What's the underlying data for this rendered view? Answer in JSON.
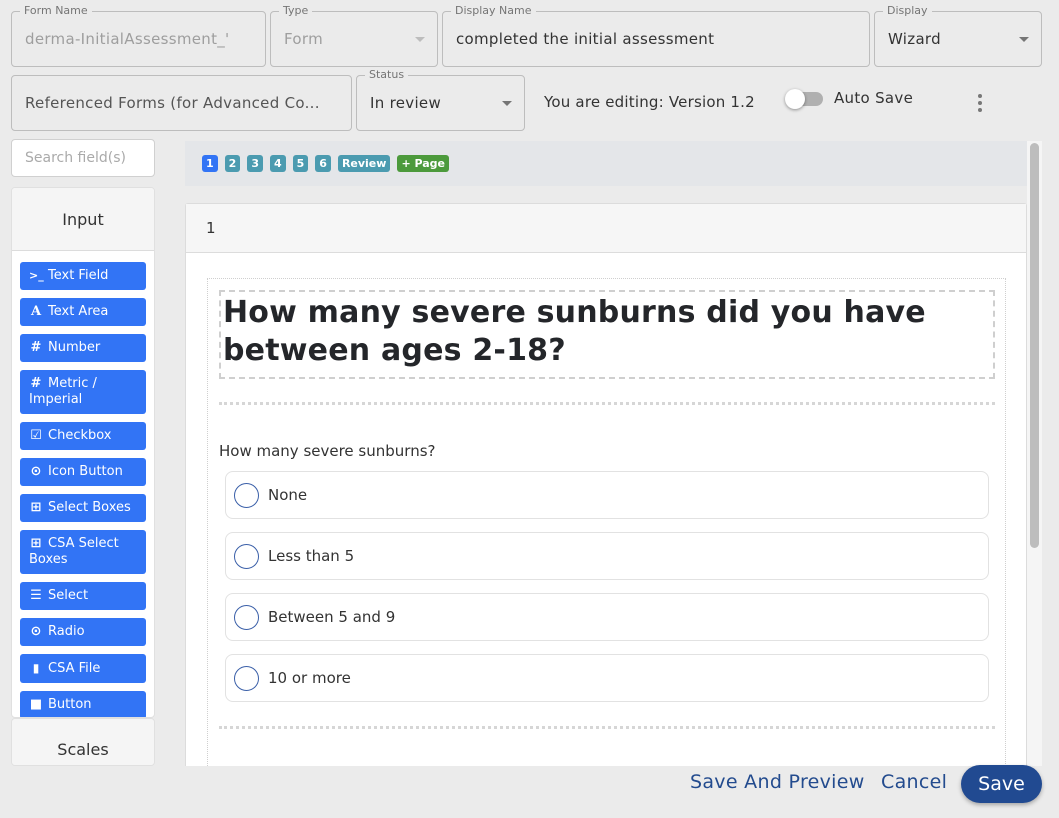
{
  "header": {
    "form_name": {
      "label": "Form Name",
      "value": "derma-InitialAssessment_'"
    },
    "type": {
      "label": "Type",
      "value": "Form"
    },
    "display_name": {
      "label": "Display Name",
      "value": "completed the initial assessment"
    },
    "display": {
      "label": "Display",
      "value": "Wizard"
    },
    "referenced_forms": {
      "value": "Referenced Forms (for Advanced Co..."
    },
    "status": {
      "label": "Status",
      "value": "In review"
    },
    "version_text": "You are editing: Version 1.2",
    "auto_save": {
      "label": "Auto Save",
      "enabled": false
    },
    "more_icon": "more-vertical-icon"
  },
  "sidebar": {
    "search_placeholder": "Search field(s)",
    "groups": [
      {
        "title": "Input",
        "items": [
          {
            "label": "Text Field",
            "icon": "terminal-icon",
            "glyph": ">_"
          },
          {
            "label": "Text Area",
            "icon": "font-icon",
            "glyph": "A"
          },
          {
            "label": "Number",
            "icon": "hashtag-icon",
            "glyph": "#"
          },
          {
            "label": "Metric / Imperial",
            "icon": "hashtag-icon",
            "glyph": "#"
          },
          {
            "label": "Checkbox",
            "icon": "check-square-icon",
            "glyph": "☑"
          },
          {
            "label": "Icon Button",
            "icon": "dot-circle-icon",
            "glyph": "⊙"
          },
          {
            "label": "Select Boxes",
            "icon": "plus-square-icon",
            "glyph": "⊞"
          },
          {
            "label": "CSA Select Boxes",
            "icon": "plus-square-icon",
            "glyph": "⊞"
          },
          {
            "label": "Select",
            "icon": "list-icon",
            "glyph": "☰"
          },
          {
            "label": "Radio",
            "icon": "dot-circle-icon",
            "glyph": "⊙"
          },
          {
            "label": "CSA File",
            "icon": "file-icon",
            "glyph": "▮"
          },
          {
            "label": "Button",
            "icon": "stop-icon",
            "glyph": "■"
          }
        ]
      },
      {
        "title": "Scales"
      }
    ]
  },
  "pages": {
    "tabs": [
      "1",
      "2",
      "3",
      "4",
      "5",
      "6",
      "Review"
    ],
    "active": "1",
    "add_label": "+ Page"
  },
  "page_card": {
    "title": "1",
    "heading": "How many severe sunburns did you have between ages 2-18?",
    "question": {
      "label": "How many severe sunburns?",
      "options": [
        "None",
        "Less than 5",
        "Between 5 and 9",
        "10 or more"
      ],
      "selected": null
    }
  },
  "footer": {
    "save_and_preview": "Save And Preview",
    "cancel": "Cancel",
    "save": "Save"
  },
  "colors": {
    "primary": "#3274f5",
    "page_tab": "#4b9bb0",
    "add_page": "#4c9a3c",
    "save": "#214a91"
  }
}
